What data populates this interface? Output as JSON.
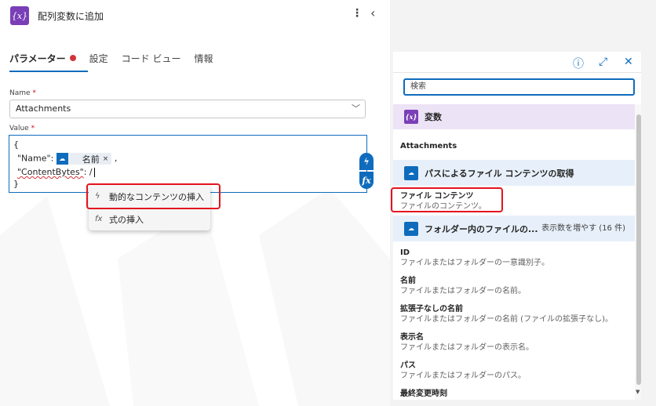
{
  "header": {
    "icon": "{x}",
    "title": "配列変数に追加",
    "more_icon": "⋮",
    "collapse_icon": "‹"
  },
  "tabs": [
    {
      "label": "パラメーター",
      "active": true,
      "required_dot": true
    },
    {
      "label": "設定"
    },
    {
      "label": "コード ビュー"
    },
    {
      "label": "情報"
    }
  ],
  "form": {
    "name_label": "Name",
    "required_mark": "*",
    "name_value": "Attachments",
    "value_label": "Value",
    "editor": {
      "line1": "{",
      "line2_key": "\"Name\":",
      "line2_token": "名前",
      "line2_token_close": "×",
      "line2_suffix": ",",
      "line3_key": "\"ContentBytes\"",
      "line3_colon": ": /",
      "line4": "}"
    },
    "side_buttons": {
      "dynamic": "ϟ",
      "expression": "fx"
    }
  },
  "insert_menu": {
    "items": [
      {
        "icon": "ϟ",
        "label": "動的なコンテンツの挿入"
      },
      {
        "icon": "fx",
        "label": "式の挿入"
      }
    ]
  },
  "dynamic_panel": {
    "icons": {
      "info": "ⓘ",
      "expand": "⤢",
      "close": "✕"
    },
    "search_placeholder": "検索",
    "variables_label": "変数",
    "section_label": "Attachments",
    "group1": {
      "title": "パスによるファイル コンテンツの取得"
    },
    "file_content": {
      "title": "ファイル コンテンツ",
      "desc": "ファイルのコンテンツ。"
    },
    "group2": {
      "title": "フォルダー内のファイルの...",
      "more": "表示数を増やす (16 件)"
    },
    "items": [
      {
        "title": "ID",
        "desc": "ファイルまたはフォルダーの一意識別子。"
      },
      {
        "title": "名前",
        "desc": "ファイルまたはフォルダーの名前。"
      },
      {
        "title": "拡張子なしの名前",
        "desc": "ファイルまたはフォルダーの名前 (ファイルの拡張子なし)。"
      },
      {
        "title": "表示名",
        "desc": "ファイルまたはフォルダーの表示名。"
      },
      {
        "title": "パス",
        "desc": "ファイルまたはフォルダーのパス。"
      },
      {
        "title": "最終変更時刻",
        "desc": ""
      }
    ]
  },
  "colors": {
    "accent": "#0f6cbd",
    "variable_purple": "#7a3fb7",
    "highlight_red": "#e3141e",
    "required_red": "#d13438"
  }
}
